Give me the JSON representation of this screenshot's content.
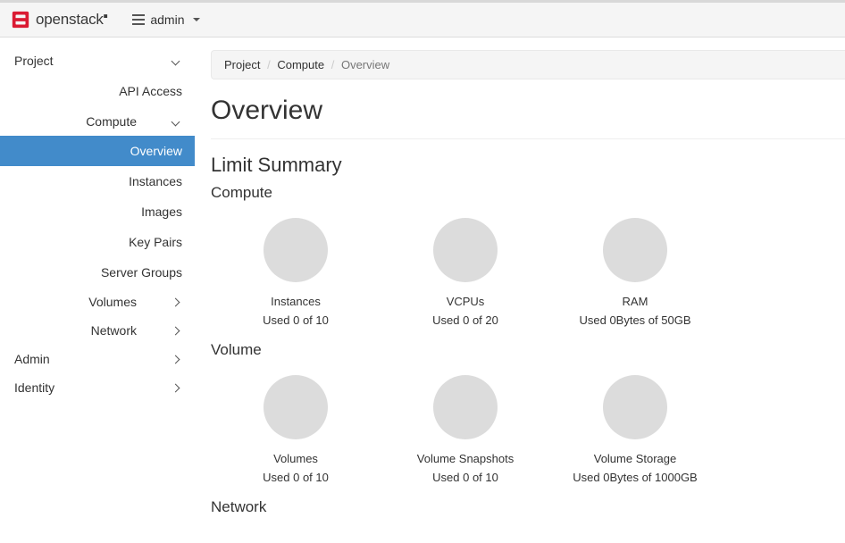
{
  "topbar": {
    "brand": "openstack",
    "project_selector": "admin"
  },
  "sidebar": {
    "project": "Project",
    "api_access": "API Access",
    "compute": "Compute",
    "compute_items": {
      "overview": "Overview",
      "instances": "Instances",
      "images": "Images",
      "key_pairs": "Key Pairs",
      "server_groups": "Server Groups"
    },
    "volumes": "Volumes",
    "network": "Network",
    "admin": "Admin",
    "identity": "Identity"
  },
  "breadcrumb": {
    "project": "Project",
    "compute": "Compute",
    "overview": "Overview"
  },
  "page": {
    "title": "Overview",
    "limit_summary": "Limit Summary",
    "sections": {
      "compute": "Compute",
      "volume": "Volume",
      "network": "Network"
    }
  },
  "limits": {
    "compute": [
      {
        "label": "Instances",
        "usage": "Used 0 of 10"
      },
      {
        "label": "VCPUs",
        "usage": "Used 0 of 20"
      },
      {
        "label": "RAM",
        "usage": "Used 0Bytes of 50GB"
      }
    ],
    "volume": [
      {
        "label": "Volumes",
        "usage": "Used 0 of 10"
      },
      {
        "label": "Volume Snapshots",
        "usage": "Used 0 of 10"
      },
      {
        "label": "Volume Storage",
        "usage": "Used 0Bytes of 1000GB"
      }
    ]
  }
}
